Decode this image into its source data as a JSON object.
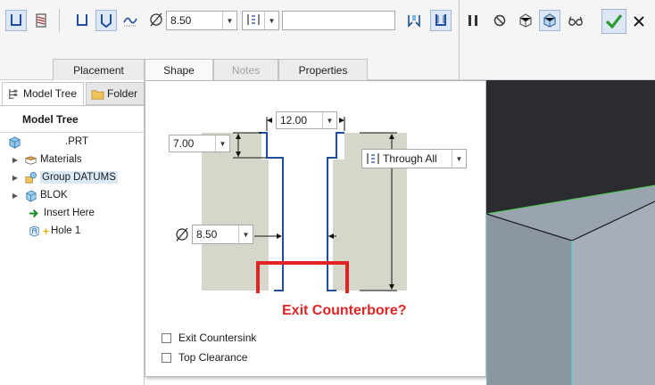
{
  "ribbon": {
    "diameter_value": "8.50",
    "dialog_tabs": [
      "Placement",
      "Shape",
      "Notes",
      "Properties"
    ],
    "active_tab": "Shape"
  },
  "model_tree": {
    "panel_tabs": [
      "Model Tree",
      "Folder"
    ],
    "header": "Model Tree",
    "items": [
      {
        "label": ".PRT",
        "icon": "part-icon"
      },
      {
        "label": "Materials",
        "icon": "materials-icon"
      },
      {
        "label": "Group DATUMS",
        "icon": "group-icon"
      },
      {
        "label": "BLOK",
        "icon": "extrude-icon"
      },
      {
        "label": "Insert Here",
        "icon": "insert-arrow-icon"
      },
      {
        "label": "Hole 1",
        "icon": "hole-icon"
      }
    ]
  },
  "shape_panel": {
    "counterbore_diameter": "12.00",
    "counterbore_depth": "7.00",
    "hole_diameter": "8.50",
    "depth_option": "Through All",
    "annotation": "Exit Counterbore?",
    "options": [
      {
        "label": "Exit Countersink",
        "checked": false
      },
      {
        "label": "Top Clearance",
        "checked": false
      }
    ]
  },
  "colors": {
    "accent_blue": "#1f4e9c",
    "annotation_red": "#e02424",
    "confirm_green": "#2e9b2e",
    "graphics_bg": "#2a2c30"
  }
}
